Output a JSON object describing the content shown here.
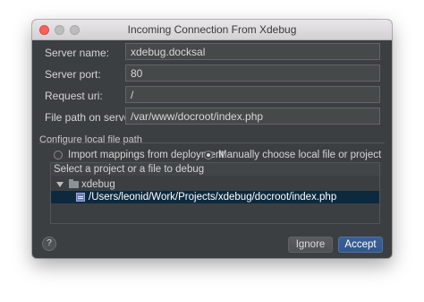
{
  "window": {
    "title": "Incoming Connection From Xdebug"
  },
  "form": {
    "server_name_label": "Server name:",
    "server_name_value": "xdebug.docksal",
    "server_port_label": "Server port:",
    "server_port_value": "80",
    "request_uri_label": "Request uri:",
    "request_uri_value": "/",
    "file_path_label": "File path on server:",
    "file_path_value": "/var/www/docroot/index.php"
  },
  "configure": {
    "section_label": "Configure local file path",
    "option_import": "Import mappings from deployment",
    "option_manual": "Manually choose local file or project",
    "selected_option": "manual"
  },
  "tree": {
    "header": "Select a project or a file to debug",
    "project_name": "xdebug",
    "file_path": "/Users/leonid/Work/Projects/xdebug/docroot/index.php"
  },
  "buttons": {
    "help": "?",
    "ignore": "Ignore",
    "accept": "Accept"
  },
  "colors": {
    "dialog_background": "#3c3f41",
    "selection": "#0d293e",
    "accept_button": "#365880"
  },
  "icons": {
    "close": "close-icon",
    "minimize": "minimize-icon",
    "maximize": "maximize-icon",
    "expand": "triangle-down-icon",
    "folder": "folder-icon",
    "php_file": "php-file-icon"
  }
}
